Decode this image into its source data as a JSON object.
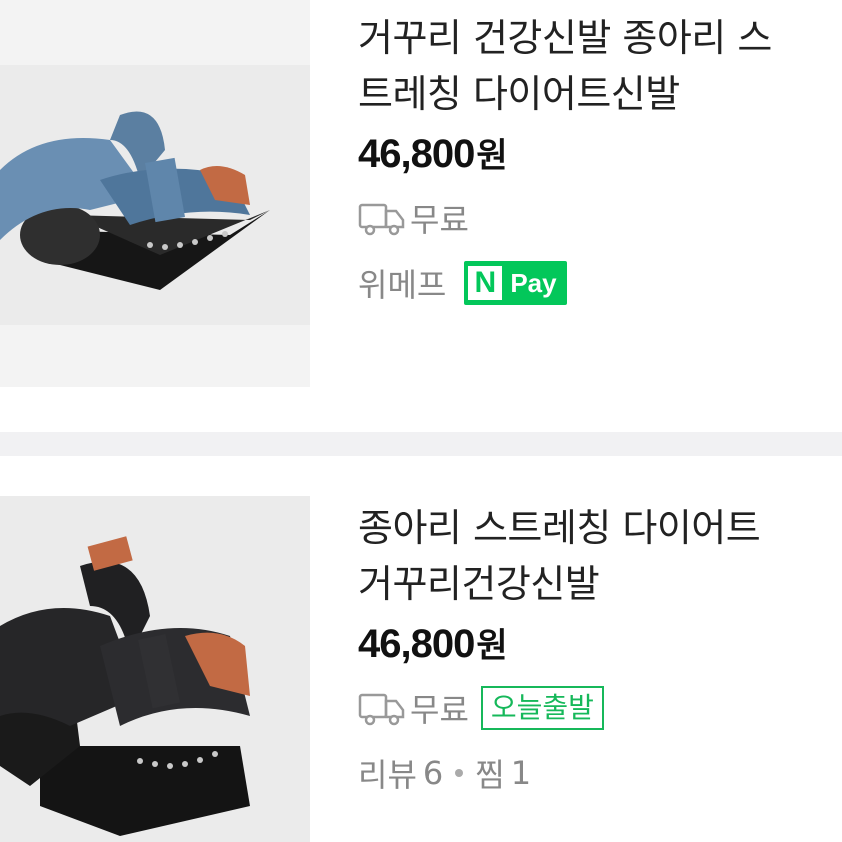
{
  "products": [
    {
      "title": "거꾸리 건강신발 종아리 스트레칭 다이어트신발",
      "price": "46,800",
      "currency": "원",
      "shipping": "무료",
      "seller": "위메프",
      "npay_mark": "N",
      "npay_label": "Pay",
      "image_color": "#5b7fa1"
    },
    {
      "title": "종아리 스트레칭 다이어트 거꾸리건강신발",
      "price": "46,800",
      "currency": "원",
      "shipping": "무료",
      "badge": "오늘출발",
      "review_label": "리뷰",
      "review_count": "6",
      "wish_label": "찜",
      "wish_count": "1",
      "image_color": "#1f1f22"
    }
  ],
  "colors": {
    "accent": "#03c75a",
    "muted": "#888888"
  },
  "icons": {
    "shipping": "truck-icon",
    "dot": "dot-separator"
  }
}
